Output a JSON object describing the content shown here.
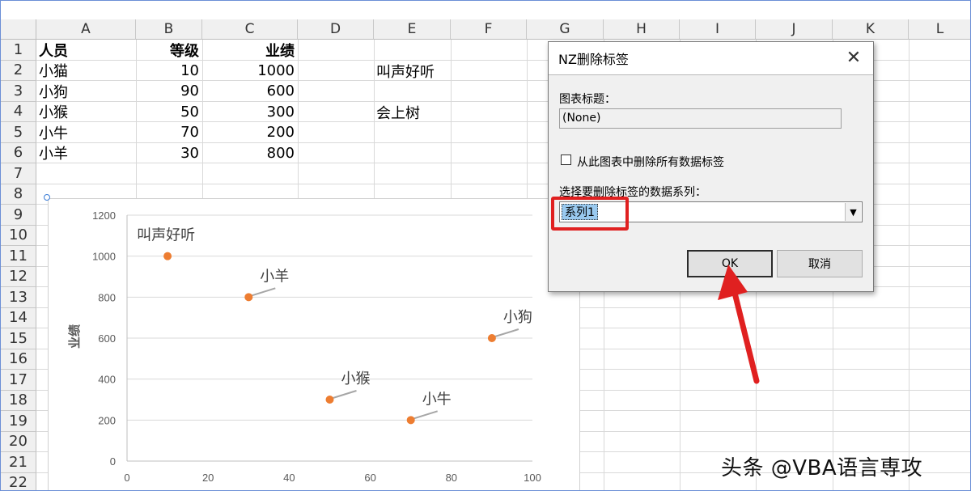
{
  "columns": [
    "A",
    "B",
    "C",
    "D",
    "E",
    "F",
    "G",
    "H",
    "I",
    "J",
    "K",
    "L"
  ],
  "rows": [
    "1",
    "2",
    "3",
    "4",
    "5",
    "6",
    "7",
    "8",
    "9",
    "10",
    "11",
    "12",
    "13",
    "14",
    "15",
    "16",
    "17",
    "18",
    "19",
    "20",
    "21",
    "22"
  ],
  "sheet": {
    "headers": {
      "a": "人员",
      "b": "等级",
      "c": "业绩"
    },
    "records": [
      {
        "name": "小猫",
        "grade": "10",
        "perf": "1000"
      },
      {
        "name": "小狗",
        "grade": "90",
        "perf": "600"
      },
      {
        "name": "小猴",
        "grade": "50",
        "perf": "300"
      },
      {
        "name": "小牛",
        "grade": "70",
        "perf": "200"
      },
      {
        "name": "小羊",
        "grade": "30",
        "perf": "800"
      }
    ],
    "e2": "叫声好听",
    "e4": "会上树"
  },
  "chart_data": {
    "type": "scatter",
    "ylabel": "业绩",
    "xlim": [
      0,
      100
    ],
    "ylim": [
      0,
      1200
    ],
    "xticks": [
      "0",
      "20",
      "40",
      "60",
      "80",
      "100"
    ],
    "yticks": [
      "0",
      "200",
      "400",
      "600",
      "800",
      "1000",
      "1200"
    ],
    "marker_color": "#ed7d31",
    "points": [
      {
        "x": 10,
        "y": 1000,
        "label": "叫声好听"
      },
      {
        "x": 90,
        "y": 600,
        "label": "小狗"
      },
      {
        "x": 50,
        "y": 300,
        "label": "小猴"
      },
      {
        "x": 70,
        "y": 200,
        "label": "小牛"
      },
      {
        "x": 30,
        "y": 800,
        "label": "小羊"
      }
    ]
  },
  "dialog": {
    "title": "NZ删除标签",
    "chart_title_label": "图表标题：",
    "chart_title_value": "(None)",
    "delete_all_label": "从此图表中删除所有数据标签",
    "series_label": "选择要删除标签的数据系列：",
    "series_value": "系列1",
    "ok": "OK",
    "cancel": "取消"
  },
  "watermark": "头条 @VBA语言専攻"
}
